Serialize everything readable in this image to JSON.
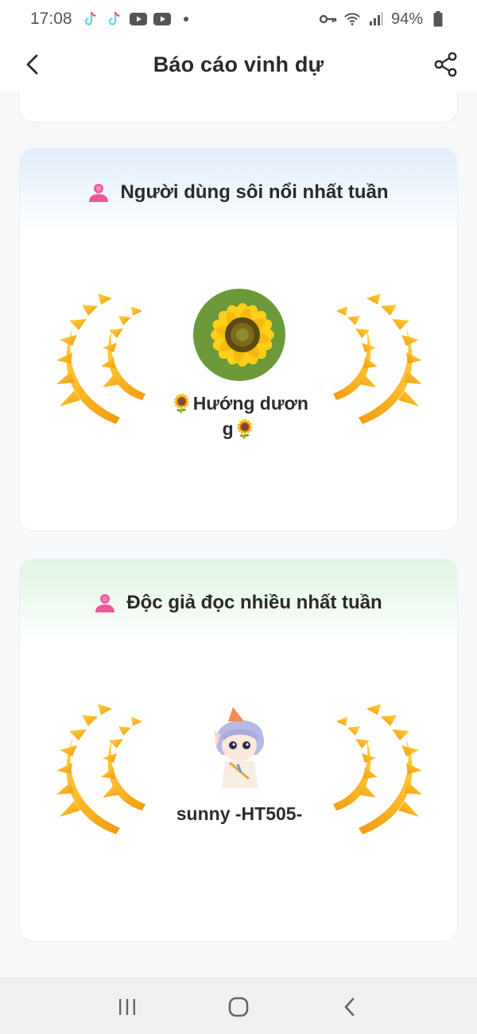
{
  "status_bar": {
    "time": "17:08",
    "battery": "94%",
    "icons": [
      "tiktok-icon",
      "tiktok-icon",
      "youtube-icon",
      "youtube-icon",
      "dot-icon",
      "key-icon",
      "wifi-icon",
      "signal-icon",
      "battery-icon"
    ]
  },
  "header": {
    "title": "Báo cáo vinh dự",
    "back_icon": "chevron-left-icon",
    "share_icon": "share-icon"
  },
  "cards": [
    {
      "title": "Người dùng sôi nổi nhất tuần",
      "icon": "person-icon",
      "winner_name": "🌻Hướng dương🌻",
      "avatar": "sunflower-avatar",
      "accent": "#e2eefc"
    },
    {
      "title": "Độc giả đọc nhiều nhất tuần",
      "icon": "person-icon",
      "winner_name": "sunny -HT505-",
      "avatar": "anime-character-avatar",
      "accent": "#e0f5e4"
    }
  ],
  "colors": {
    "laurel_light": "#ffd23a",
    "laurel_dark": "#f39a12",
    "person_icon": "#f0569a"
  },
  "nav_bar": {
    "items": [
      "recent-apps-icon",
      "home-icon",
      "back-icon"
    ]
  }
}
